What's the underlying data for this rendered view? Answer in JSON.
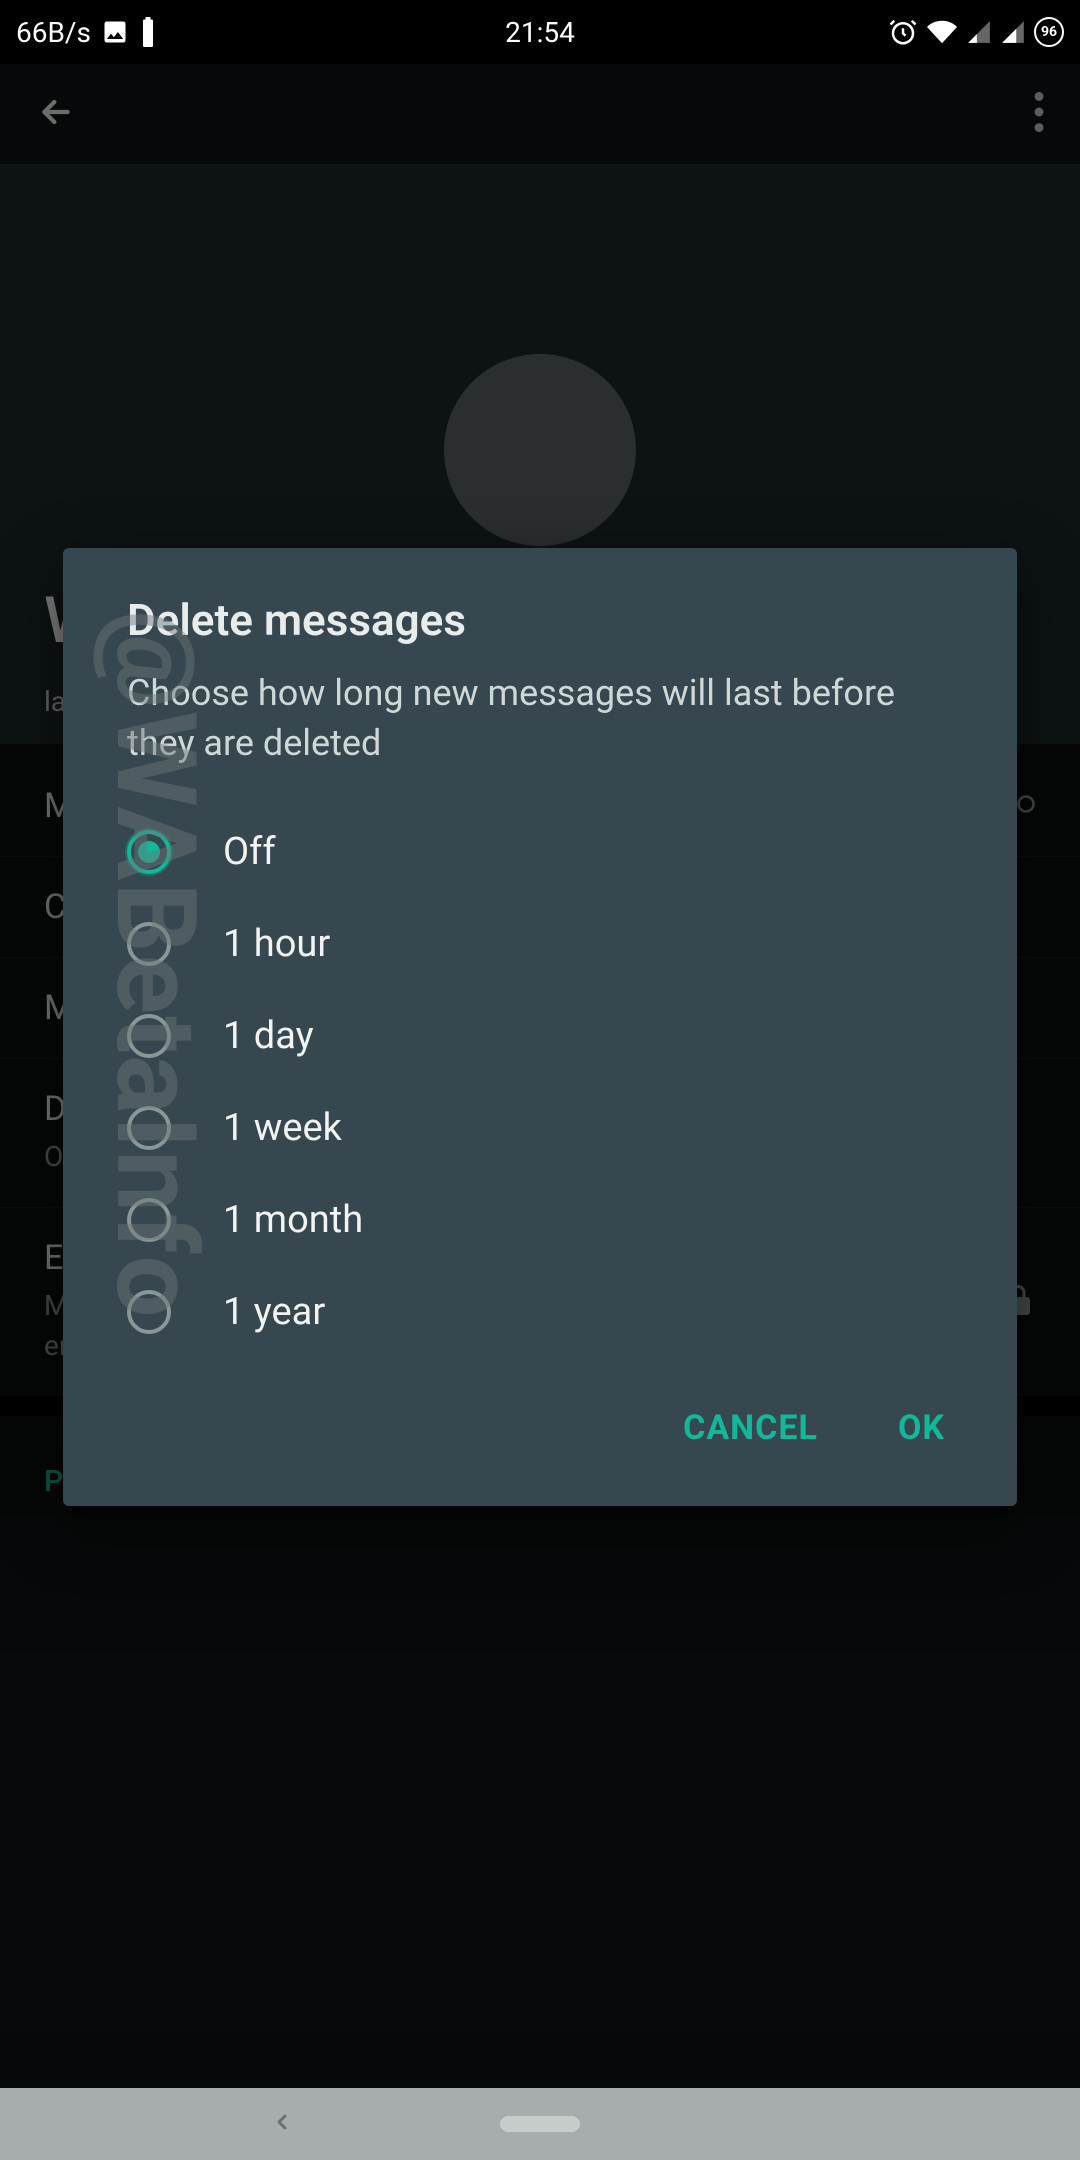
{
  "statusbar": {
    "net_speed": "66B/s",
    "time": "21:54",
    "badge": "96"
  },
  "page": {
    "contact_name": "W",
    "contact_sub": "la",
    "items": {
      "m1": "M",
      "c1": "C",
      "m2": "M",
      "d1": "D",
      "d1_sub": "O",
      "encryption_title": "Encryption",
      "encryption_sub": "Messages to this chat and calls are secured with end-to-end encryption. Tap to verify."
    },
    "section_phone": "Phone number"
  },
  "dialog": {
    "title": "Delete messages",
    "description": "Choose how long new messages will last before they are deleted",
    "options": [
      {
        "label": "Off",
        "selected": true
      },
      {
        "label": "1 hour",
        "selected": false
      },
      {
        "label": "1 day",
        "selected": false
      },
      {
        "label": "1 week",
        "selected": false
      },
      {
        "label": "1 month",
        "selected": false
      },
      {
        "label": "1 year",
        "selected": false
      }
    ],
    "cancel": "CANCEL",
    "ok": "OK"
  },
  "watermark": "@WABetaInfo"
}
